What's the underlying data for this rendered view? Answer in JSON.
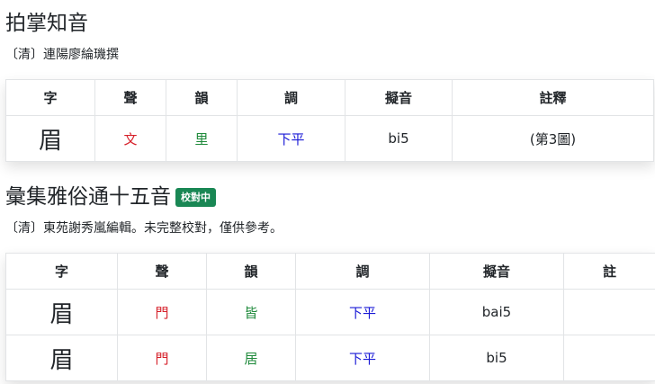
{
  "section1": {
    "title": "拍掌知音",
    "subtitle": "〔清〕連陽廖綸璣撰",
    "headers": [
      "字",
      "聲",
      "韻",
      "調",
      "擬音",
      "註釋"
    ],
    "rows": [
      {
        "char": "眉",
        "initial": "文",
        "final": "里",
        "tone": "下平",
        "reading": "bi5",
        "note": "(第3圖)"
      }
    ]
  },
  "section2": {
    "title": "彙集雅俗通十五音",
    "badge": "校對中",
    "subtitle": "〔清〕東苑謝秀嵐編輯。未完整校對，僅供參考。",
    "headers": [
      "字",
      "聲",
      "韻",
      "調",
      "擬音",
      "註"
    ],
    "rows": [
      {
        "char": "眉",
        "initial": "門",
        "final": "皆",
        "tone": "下平",
        "reading": "bai5",
        "note": ""
      },
      {
        "char": "眉",
        "initial": "門",
        "final": "居",
        "tone": "下平",
        "reading": "bi5",
        "note": ""
      }
    ]
  },
  "colors": {
    "initial": "#d6202a",
    "final": "#1f8a3b",
    "tone": "#1a1ad6",
    "badge": "#198754"
  }
}
